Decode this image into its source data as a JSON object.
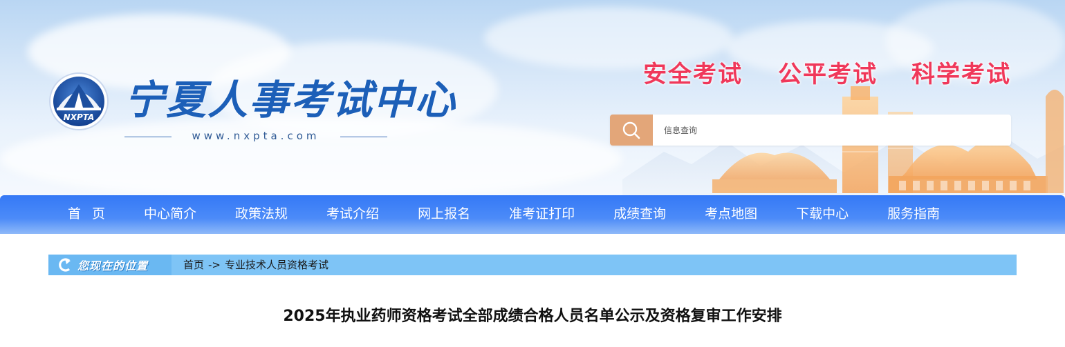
{
  "header": {
    "site_name": "宁夏人事考试中心",
    "site_url": "www.nxpta.com",
    "logo_text": "NXPTA",
    "slogans": [
      "安全考试",
      "公平考试",
      "科学考试"
    ],
    "search": {
      "placeholder": "信息查询"
    },
    "colors": {
      "slogan": "#f0385a",
      "search_button": "#e3a679",
      "brand_blue": "#1c5fb8"
    }
  },
  "nav": {
    "items": [
      {
        "label": "首页"
      },
      {
        "label": "中心简介"
      },
      {
        "label": "政策法规"
      },
      {
        "label": "考试介绍"
      },
      {
        "label": "网上报名"
      },
      {
        "label": "准考证打印"
      },
      {
        "label": "成绩查询"
      },
      {
        "label": "考点地图"
      },
      {
        "label": "下载中心"
      },
      {
        "label": "服务指南"
      }
    ],
    "color": "#3579f6"
  },
  "breadcrumb": {
    "label": "您现在的位置",
    "home": "首页",
    "separator": "->",
    "current": "专业技术人员资格考试"
  },
  "article": {
    "title": "2025年执业药师资格考试全部成绩合格人员名单公示及资格复审工作安排"
  }
}
